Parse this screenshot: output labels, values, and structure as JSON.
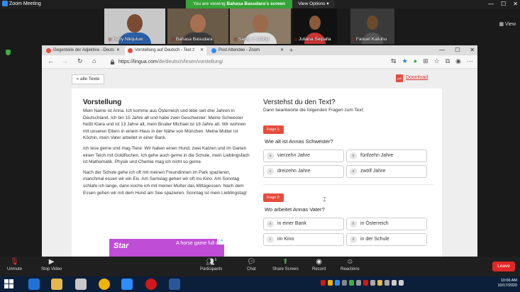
{
  "zoom": {
    "title": "Zoom Meeting",
    "viewing_prefix": "You are viewing ",
    "viewing_name": "Bahasa Basudara's screen",
    "view_options": "View Options",
    "view_button": "View",
    "participants_thumbs": [
      {
        "name": "Heny Nikijuluw",
        "muted": true
      },
      {
        "name": "Bahasa Basudara",
        "muted": true
      },
      {
        "name": "Samy J. Litiloly",
        "muted": true
      },
      {
        "name": "Juliana Seipalla",
        "muted": true
      },
      {
        "name": "Fanuel Kailuhu",
        "muted": true
      }
    ],
    "bottom": {
      "unmute": "Unmute",
      "stop_video": "Stop Video",
      "participants": "Participants",
      "participants_count": "5",
      "chat": "Chat",
      "share_screen": "Share Screen",
      "record": "Record",
      "reactions": "Reactions",
      "leave": "Leave"
    }
  },
  "browser": {
    "tabs": [
      {
        "label": "Gegenteile der Adjektive - Deuts",
        "active": false
      },
      {
        "label": "Vorstellung auf Deutsch - Text z",
        "active": true
      },
      {
        "label": "Post Attendee - Zoom",
        "active": false
      }
    ],
    "url_host": "https://lingua.com",
    "url_path": "/de/deutsch/lesen/vorstellung/"
  },
  "page": {
    "back_label": "« alle Texte",
    "download_label": "Download",
    "pdf_label": "pdf",
    "title": "Vorstellung",
    "paragraphs": [
      "Mein Name ist Anna. Ich komme aus Österreich und lebe seit drei Jahren in Deutschland. Ich bin 15 Jahre alt und habe zwei Geschwister: Meine Schwester heißt Klara und ist 13 Jahre alt, mein Bruder Michael ist 18 Jahre alt. Wir wohnen mit unseren Eltern in einem Haus in der Nähe von München. Meine Mutter ist Köchin, mein Vater arbeitet in einer Bank.",
      "Ich lese gerne und mag Tiere: Wir haben einen Hund, zwei Katzen und im Garten einen Teich mit Goldfischen. Ich gehe auch gerne in die Schule, mein Lieblingsfach ist Mathematik. Physik und Chemie mag ich nicht so gerne.",
      "Nach der Schule gehe ich oft mit meinen Freundinnen im Park spazieren, manchmal essen wir ein Eis. Am Samstag gehen wir oft ins Kino. Am Sonntag schlafe ich lange, dann koche ich mit meiner Mutter das Mittagessen. Nach dem Essen gehen wir mit dem Hund am See spazieren. Sonntag ist mein Lieblingstag!"
    ],
    "ad": {
      "logo": "Star",
      "text": "A horse game full of"
    },
    "quiz_title": "Verstehst du den Text?",
    "quiz_sub": "Dann beantworte die folgenden Fragen zum Text:",
    "questions": [
      {
        "badge": "Frage 1:",
        "text": "Wie alt ist Annas Schwester?",
        "options": [
          {
            "letter": "a",
            "label": "vierzehn Jahre"
          },
          {
            "letter": "b",
            "label": "fünfzehn Jahre"
          },
          {
            "letter": "c",
            "label": "dreizehn Jahre"
          },
          {
            "letter": "d",
            "label": "zwölf Jahre"
          }
        ]
      },
      {
        "badge": "Frage 2:",
        "text": "Wo arbeitet Annas Vater?",
        "options": [
          {
            "letter": "a",
            "label": "in einer Bank"
          },
          {
            "letter": "b",
            "label": "in Österreich"
          },
          {
            "letter": "c",
            "label": "im Kino"
          },
          {
            "letter": "d",
            "label": "in der Schule"
          }
        ]
      }
    ]
  },
  "taskbar": {
    "time": "10:06 AM",
    "date": "10/17/2020"
  },
  "colors": {
    "accent_red": "#e74c3c",
    "zoom_green": "#35a335",
    "leave_red": "#e02828"
  }
}
